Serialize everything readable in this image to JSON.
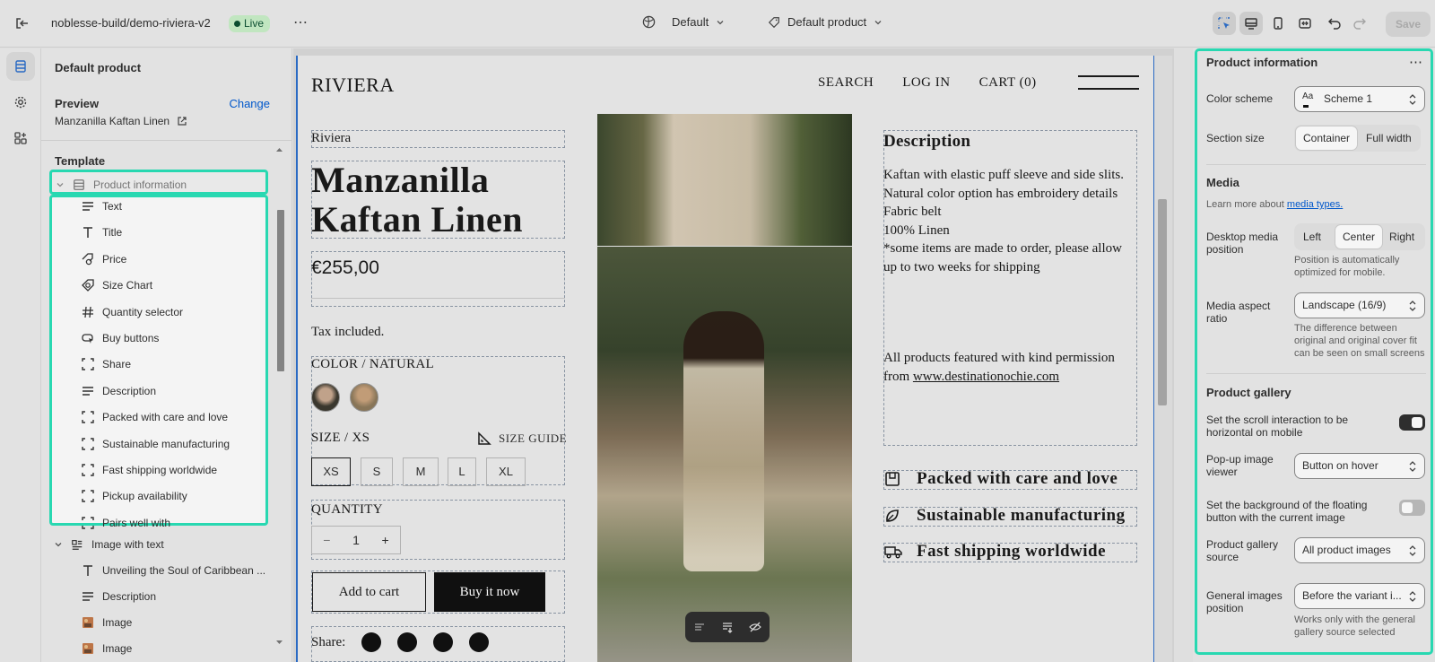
{
  "topbar": {
    "store_name": "noblesse-build/demo-riviera-v2",
    "live_badge": "Live",
    "more": "⋯",
    "theme_select": "Default",
    "template_select": "Default product",
    "save": "Save"
  },
  "sidebar": {
    "header": "Default product",
    "preview_label": "Preview",
    "change_link": "Change",
    "preview_product": "Manzanilla Kaftan Linen",
    "template_label": "Template",
    "section1": "Product information",
    "blocks": [
      {
        "label": "Text",
        "icon": "text-lines-icon"
      },
      {
        "label": "Title",
        "icon": "title-icon"
      },
      {
        "label": "Price",
        "icon": "price-tag-icon"
      },
      {
        "label": "Size Chart",
        "icon": "size-chart-icon"
      },
      {
        "label": "Quantity selector",
        "icon": "hash-icon"
      },
      {
        "label": "Buy buttons",
        "icon": "buy-button-icon"
      },
      {
        "label": "Share",
        "icon": "dashed-square-icon"
      },
      {
        "label": "Description",
        "icon": "text-lines-icon"
      },
      {
        "label": "Packed with care and love",
        "icon": "dashed-square-icon"
      },
      {
        "label": "Sustainable manufacturing",
        "icon": "dashed-square-icon"
      },
      {
        "label": "Fast shipping worldwide",
        "icon": "dashed-square-icon"
      },
      {
        "label": "Pickup availability",
        "icon": "dashed-square-icon"
      },
      {
        "label": "Pairs well with",
        "icon": "dashed-square-icon"
      }
    ],
    "section2": "Image with text",
    "section2_blocks": [
      {
        "label": "Unveiling the Soul of Caribbean ...",
        "icon": "title-icon"
      },
      {
        "label": "Description",
        "icon": "text-lines-icon"
      },
      {
        "label": "Image",
        "icon": "image-thumb-icon"
      },
      {
        "label": "Image",
        "icon": "image-thumb-icon"
      }
    ]
  },
  "store": {
    "logo": "RIVIERA",
    "nav": [
      "SEARCH",
      "LOG IN",
      "CART (0)"
    ],
    "vendor": "Riviera",
    "title": "Manzanilla Kaftan Linen",
    "price": "€255,00",
    "tax": "Tax included.",
    "color_label": "COLOR",
    "color_value": "NATURAL",
    "size_label": "SIZE",
    "size_value": "XS",
    "size_guide": "SIZE GUIDE",
    "sizes": [
      "XS",
      "S",
      "M",
      "L",
      "XL"
    ],
    "quantity_label": "QUANTITY",
    "quantity_minus": "−",
    "quantity_value": "1",
    "quantity_plus": "+",
    "add_to_cart": "Add to cart",
    "buy_now": "Buy it now",
    "share_label": "Share:",
    "description_heading": "Description",
    "description_lines": [
      "Kaftan with elastic puff sleeve and side slits.",
      "Natural color option has embroidery details",
      "Fabric belt",
      "100% Linen",
      "*some items are made to order, please allow up to two weeks for shipping"
    ],
    "permission_text": "All products featured with kind permission",
    "permission_from": "from",
    "permission_link": "www.destinationochie.com",
    "features": [
      "Packed with care and love",
      "Sustainable manufacturing",
      "Fast shipping worldwide"
    ]
  },
  "settings": {
    "title": "Product information",
    "more": "⋯",
    "color_scheme_label": "Color scheme",
    "color_scheme_value": "Scheme 1",
    "color_scheme_swatch": "Aa",
    "section_size_label": "Section size",
    "section_size_options": [
      "Container",
      "Full width"
    ],
    "media_heading": "Media",
    "media_learn": "Learn more about",
    "media_link": "media types.",
    "desktop_media_label": "Desktop media position",
    "desktop_media_options": [
      "Left",
      "Center",
      "Right"
    ],
    "desktop_media_help": "Position is automatically optimized for mobile.",
    "aspect_label": "Media aspect ratio",
    "aspect_value": "Landscape (16/9)",
    "aspect_help": "The difference between original and original cover fit can be seen on small screens",
    "gallery_heading": "Product gallery",
    "scroll_label": "Set the scroll interaction to be horizontal on mobile",
    "scroll_toggle": true,
    "popup_label": "Pop-up image viewer",
    "popup_value": "Button on hover",
    "floating_label": "Set the background of the floating button with the current image",
    "floating_toggle": false,
    "gallery_source_label": "Product gallery source",
    "gallery_source_value": "All product images",
    "general_images_label": "General images position",
    "general_images_value": "Before the variant i...",
    "general_images_help": "Works only with the general gallery source selected"
  },
  "colors": {
    "highlight": "#2ae0b8",
    "accent_blue": "#005bd3",
    "live_bg": "#c9efc8"
  }
}
